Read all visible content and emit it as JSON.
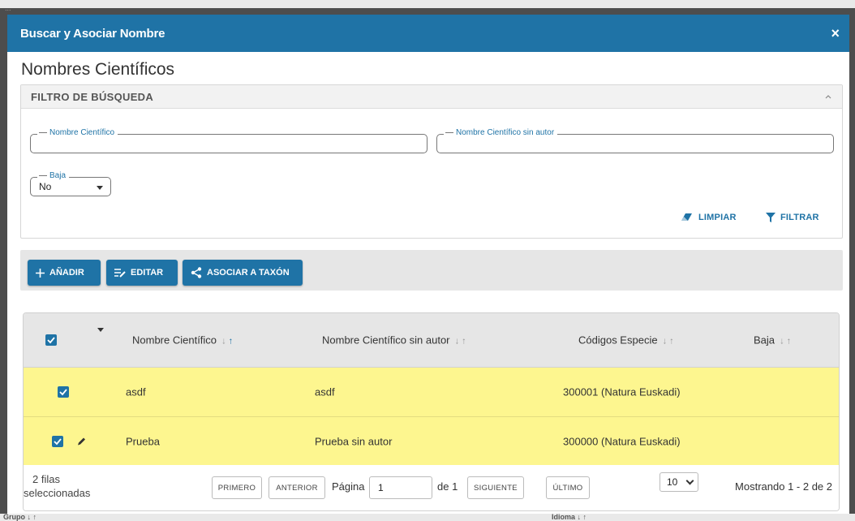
{
  "modal": {
    "title": "Buscar y Asociar Nombre",
    "close_glyph": "×",
    "page_title": "Nombres Científicos"
  },
  "filter": {
    "panel_title": "FILTRO DE BÚSQUEDA",
    "fields": {
      "nombre_cientifico": {
        "label": "Nombre Científico",
        "value": ""
      },
      "nombre_sin_autor": {
        "label": "Nombre Científico sin autor",
        "value": ""
      },
      "baja": {
        "label": "Baja",
        "selected": "No"
      }
    },
    "clear_label": "LIMPIAR",
    "filter_label": "FILTRAR"
  },
  "toolbar": {
    "add_label": "AÑADIR",
    "edit_label": "EDITAR",
    "associate_label": "ASOCIAR A TAXÓN"
  },
  "table": {
    "columns": [
      {
        "label": "Nombre Científico",
        "sort": "asc"
      },
      {
        "label": "Nombre Científico sin autor",
        "sort": "none"
      },
      {
        "label": "Códigos Especie",
        "sort": "none"
      },
      {
        "label": "Baja",
        "sort": "none"
      }
    ],
    "rows": [
      {
        "nombre": "asdf",
        "sin_autor": "asdf",
        "codigos": "300001 (Natura Euskadi)",
        "baja": "",
        "checked": true,
        "editing": false
      },
      {
        "nombre": "Prueba",
        "sin_autor": "Prueba sin autor",
        "codigos": "300000 (Natura Euskadi)",
        "baja": "",
        "checked": true,
        "editing": true
      }
    ],
    "header_checked": true
  },
  "pagination": {
    "selected_count_line1": "2 filas",
    "selected_count_line2": "seleccionadas",
    "first_label": "PRIMERO",
    "prev_label": "ANTERIOR",
    "page_label": "Página",
    "current_page": "1",
    "of_label": "de 1",
    "next_label": "SIGUIENTE",
    "last_label": "ÚLTIMO",
    "page_size": "10",
    "showing": "Mostrando 1 - 2 de 2"
  },
  "background": {
    "top_text": "...",
    "bottom_left": "Grupo ↓ ↑",
    "bottom_right": "Idioma ↓ ↑"
  },
  "colors": {
    "primary": "#1f73a6",
    "selected_row": "#fdf68f",
    "header_bg": "#e6e6e6"
  }
}
